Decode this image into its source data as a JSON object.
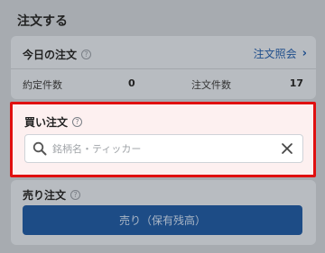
{
  "page": {
    "title": "注文する"
  },
  "today_orders": {
    "label": "今日の注文",
    "inquiry_link": "注文照会",
    "contracted_label": "約定件数",
    "contracted_value": "0",
    "orders_label": "注文件数",
    "orders_value": "17"
  },
  "buy_order": {
    "label": "買い注文",
    "search_placeholder": "銘柄名・ティッカー"
  },
  "sell_order": {
    "label": "売り注文",
    "button_label": "売り（保有残高）"
  },
  "icons": {
    "help": "question-circle-icon",
    "chevron": "chevron-right-icon",
    "search": "search-icon",
    "clear": "close-icon"
  },
  "colors": {
    "accent": "#1d4c86",
    "highlight_border": "#e01010",
    "highlight_bg": "#fdf0f0"
  }
}
